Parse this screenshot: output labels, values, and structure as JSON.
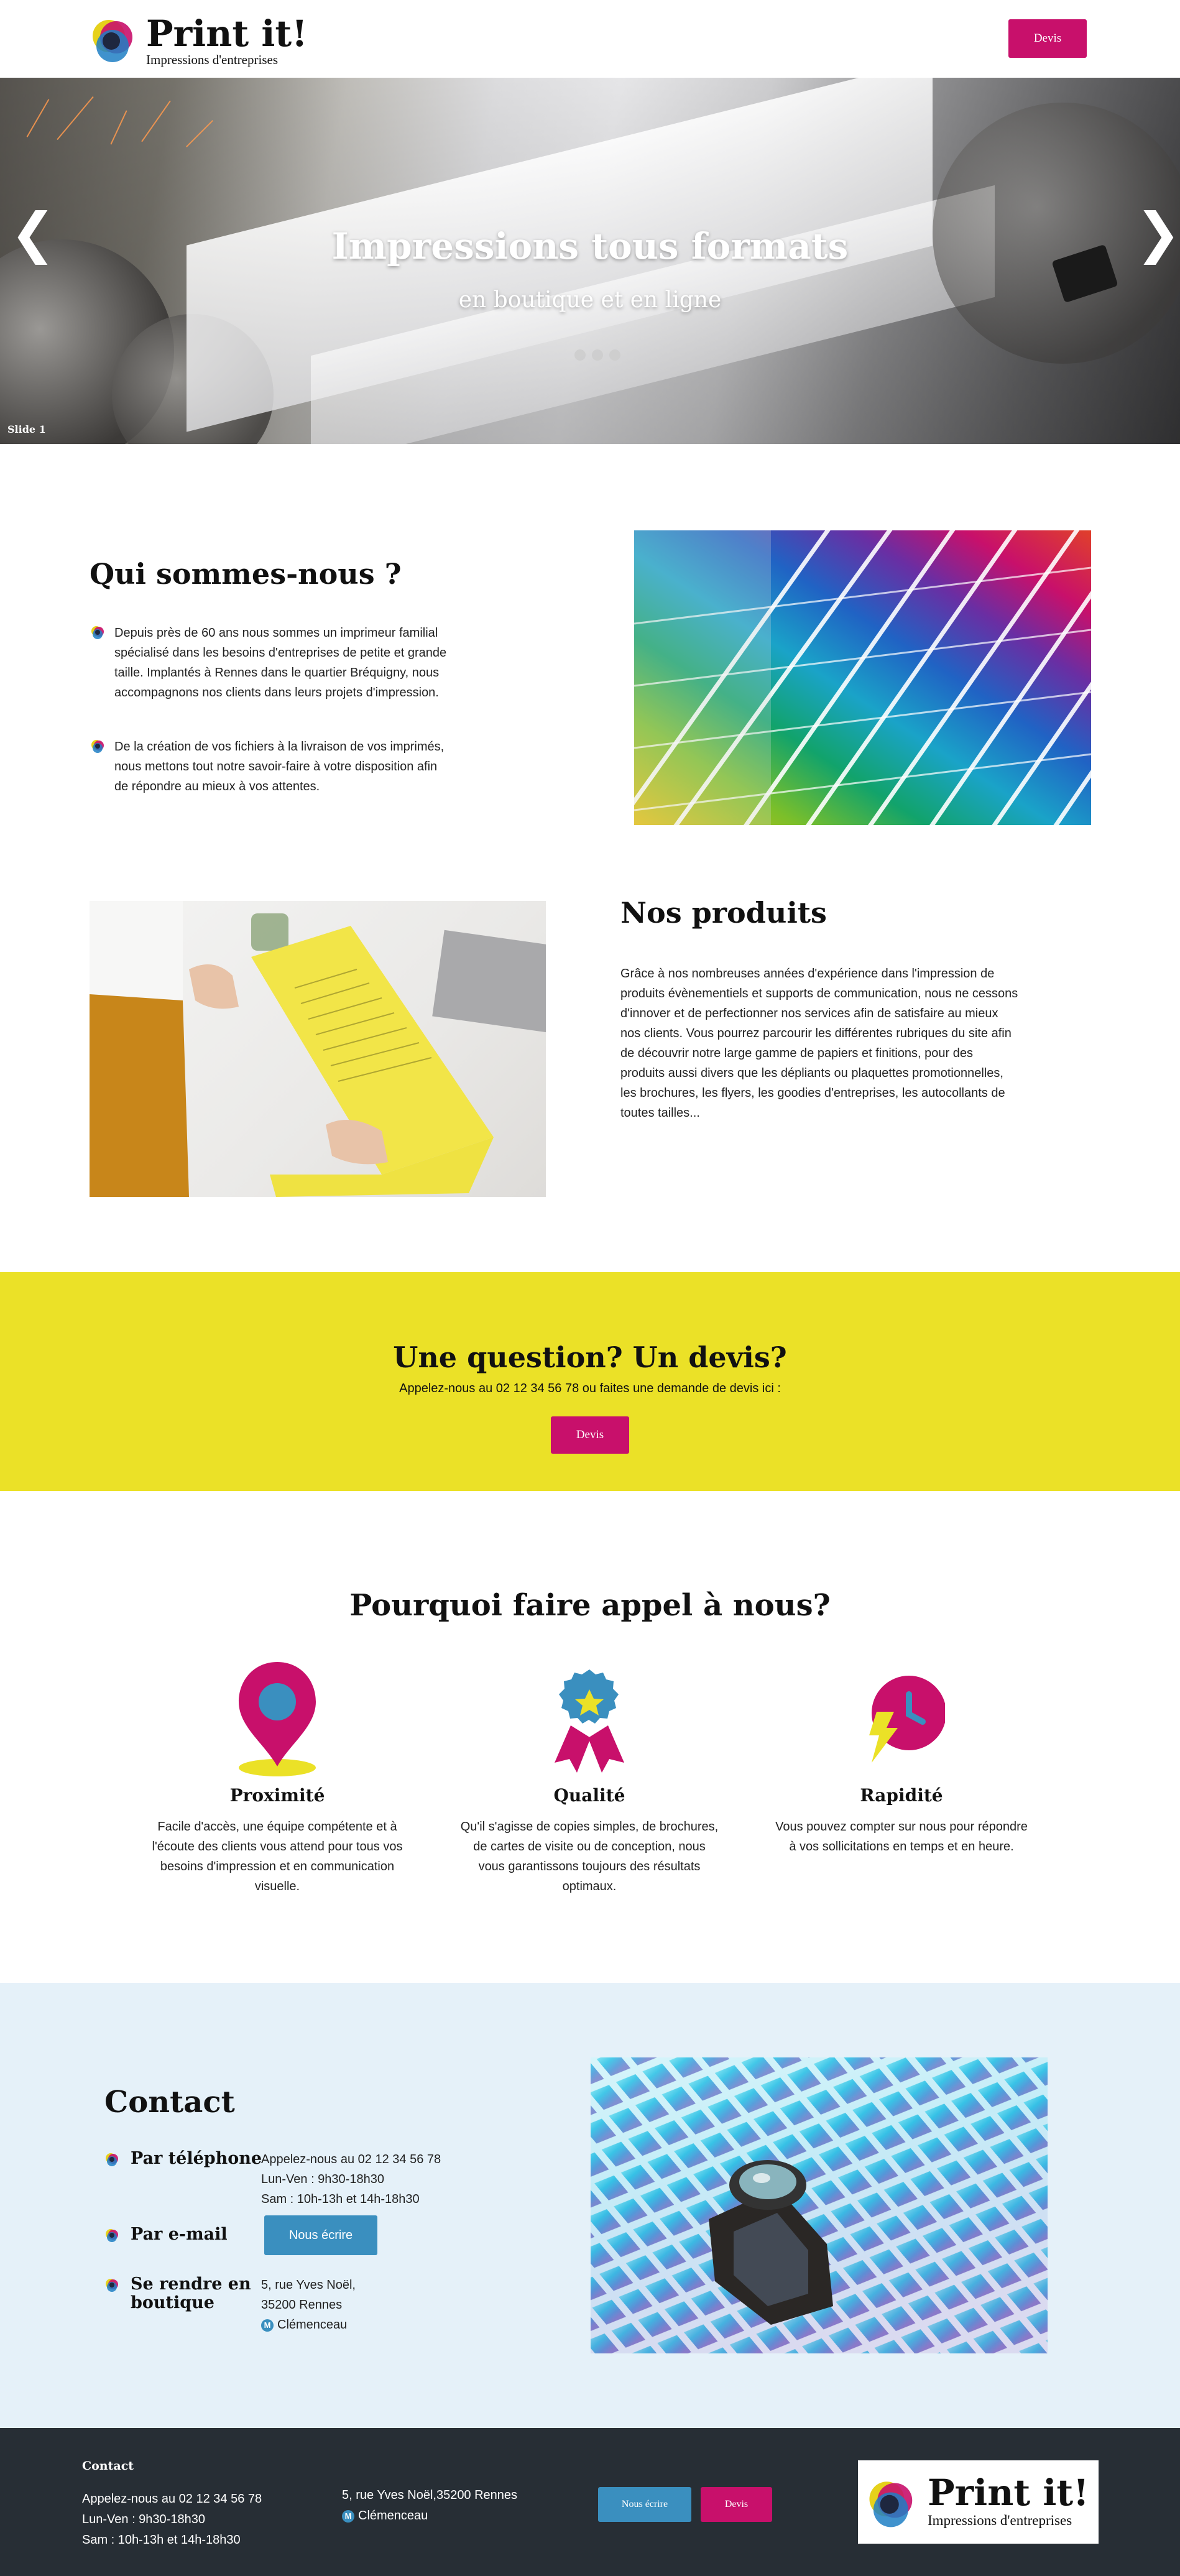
{
  "header": {
    "logo": {
      "name": "Print it!",
      "tagline": "Impressions d'entreprises"
    },
    "quote_button": "Devis"
  },
  "hero": {
    "title": "Impressions tous formats",
    "subtitle": "en boutique et en ligne",
    "slide_label": "Slide 1",
    "prev_arrow": "❮",
    "next_arrow": "❯",
    "dots_count": 3
  },
  "about": {
    "title": "Qui sommes-nous ?",
    "items": [
      "Depuis près de 60 ans nous sommes un imprimeur familial spécialisé dans les besoins d'entreprises de petite et grande taille. Implantés à Rennes dans le quartier Bréquigny, nous accompagnons nos clients dans leurs projets d'impression.",
      "De la création de vos fichiers à la livraison de vos imprimés, nous mettons tout notre savoir-faire à votre disposition afin de répondre au mieux à vos attentes."
    ]
  },
  "products": {
    "title": "Nos produits",
    "text": "Grâce à nos nombreuses années d'expérience dans l'impression de produits évènementiels et supports de communication, nous ne cessons d'innover et de perfectionner nos services afin de satisfaire au mieux nos clients. Vous pourrez parcourir les différentes rubriques du site afin de découvrir notre large gamme de papiers et finitions, pour des produits aussi divers que les dépliants ou plaquettes promotionnelles, les brochures, les flyers, les goodies d'entreprises, les autocollants de toutes tailles..."
  },
  "cta": {
    "title": "Une question? Un devis?",
    "text": "Appelez-nous au 02 12 34 56 78 ou faites une demande de devis ici :",
    "button": "Devis"
  },
  "why": {
    "title": "Pourquoi faire appel à nous?",
    "features": [
      {
        "icon": "map-pin-icon",
        "title": "Proximité",
        "text": "Facile d'accès, une équipe compétente et à l'écoute des clients vous attend pour tous vos besoins d'impression et en communication visuelle."
      },
      {
        "icon": "award-ribbon-icon",
        "title": "Qualité",
        "text": "Qu'il s'agisse de copies simples, de brochures, de cartes de visite ou de conception, nous vous garantissons toujours des résultats optimaux."
      },
      {
        "icon": "clock-lightning-icon",
        "title": "Rapidité",
        "text": "Vous pouvez compter sur nous pour répondre à vos sollicitations en temps et en heure."
      }
    ]
  },
  "contact": {
    "title": "Contact",
    "phone_label": "Par téléphone",
    "phone_lines": [
      "Appelez-nous au 02 12 34 56 78",
      "Lun-Ven : 9h30-18h30",
      "Sam : 10h-13h et 14h-18h30"
    ],
    "email_label": "Par e-mail",
    "email_button": "Nous écrire",
    "visit_label_1": "Se rendre en",
    "visit_label_2": "boutique",
    "address_lines": [
      "5, rue Yves Noël,",
      "35200 Rennes"
    ],
    "metro_badge": "M",
    "metro": "Clémenceau"
  },
  "footer": {
    "title": "Contact",
    "phone_lines": [
      "Appelez-nous au 02 12 34 56 78",
      "Lun-Ven : 9h30-18h30",
      "Sam : 10h-13h et 14h-18h30"
    ],
    "address": "5, rue Yves Noël,35200 Rennes",
    "metro_badge": "M",
    "metro": "Clémenceau",
    "write_button": "Nous écrire",
    "quote_button": "Devis",
    "logo": {
      "name": "Print it!",
      "tagline": "Impressions d'entreprises"
    }
  },
  "colors": {
    "brand_pink": "#c8106b",
    "brand_blue": "#3a8fbf",
    "cta_yellow": "#ebe127",
    "contact_bg": "#e5f1f9",
    "footer_bg": "#272e35"
  }
}
